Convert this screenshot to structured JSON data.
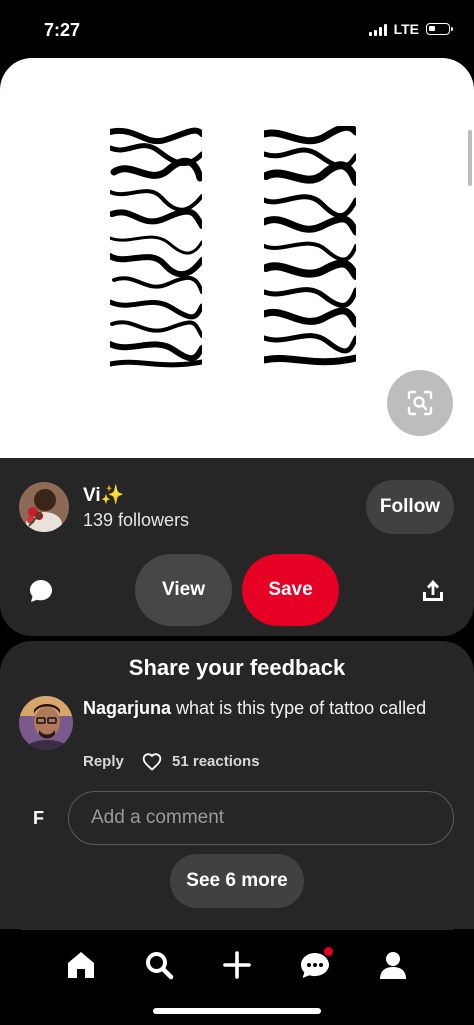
{
  "status_bar": {
    "time": "7:27",
    "network": "LTE"
  },
  "creator": {
    "name": "Vi✨",
    "followers": "139 followers",
    "follow_label": "Follow"
  },
  "actions": {
    "view_label": "View",
    "save_label": "Save"
  },
  "feedback": {
    "title": "Share your feedback",
    "comment": {
      "author": "Nagarjuna",
      "text": "what is this type of tattoo called",
      "reply_label": "Reply",
      "reactions": "51 reactions"
    },
    "user_initial": "F",
    "input_placeholder": "Add a comment",
    "see_more_label": "See 6 more"
  },
  "icons": {
    "lens": "visual-search-icon",
    "comment": "chat-bubble-icon",
    "share": "share-icon",
    "nav": [
      "home-icon",
      "search-icon",
      "plus-icon",
      "messages-icon",
      "profile-icon"
    ]
  },
  "colors": {
    "accent": "#e60023",
    "panel": "#262626",
    "button": "#414141"
  }
}
